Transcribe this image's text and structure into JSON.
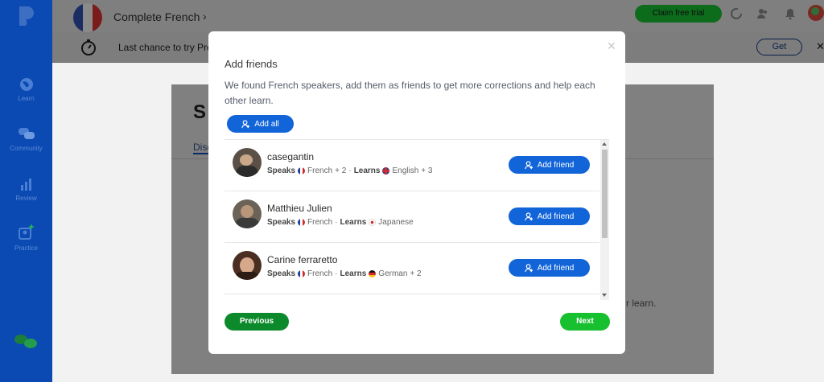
{
  "app": {
    "course_title": "Complete French",
    "claim_label": "Claim free trial"
  },
  "sidebar": {
    "items": [
      {
        "label": "Learn",
        "icon": "globe-icon"
      },
      {
        "label": "Community",
        "icon": "chat-bubbles-icon"
      },
      {
        "label": "Review",
        "icon": "bar-chart-icon"
      },
      {
        "label": "Practice",
        "icon": "practice-icon"
      }
    ]
  },
  "banner": {
    "text": "Last chance to try Pre",
    "get_label": "Get"
  },
  "background": {
    "heading": "S",
    "tab": "Disc",
    "trailing_text": "r learn."
  },
  "modal": {
    "title": "Add friends",
    "description": "We found French speakers, add them as friends to get more corrections and help each other learn.",
    "add_all_label": "Add all",
    "add_friend_label": "Add friend",
    "speaks_label": "Speaks",
    "learns_label": "Learns",
    "friends": [
      {
        "name": "casegantin",
        "speaks": "French",
        "speaks_more": "+ 2",
        "learns": "English",
        "learns_more": "+ 3",
        "learns_flag": "uk"
      },
      {
        "name": "Matthieu Julien",
        "speaks": "French",
        "speaks_more": "",
        "learns": "Japanese",
        "learns_more": "",
        "learns_flag": "japan"
      },
      {
        "name": "Carine ferraretto",
        "speaks": "French",
        "speaks_more": "",
        "learns": "German",
        "learns_more": "+ 2",
        "learns_flag": "germany"
      }
    ],
    "previous_label": "Previous",
    "next_label": "Next"
  },
  "colors": {
    "primary_blue": "#1264d9",
    "sidebar_blue": "#0b4ab3",
    "next_green": "#17c02e",
    "previous_green": "#0c8a2b"
  }
}
